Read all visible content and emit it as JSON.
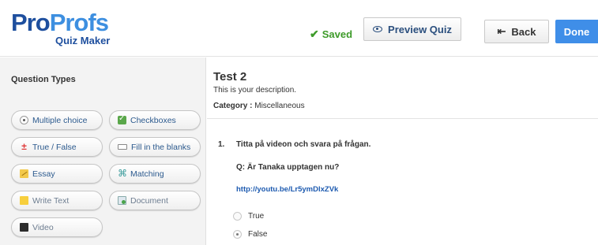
{
  "header": {
    "logo_pro": "Pro",
    "logo_profs": "Profs",
    "logo_sub": "Quiz Maker",
    "saved_label": "Saved",
    "preview_label": "Preview Quiz",
    "back_label": "Back",
    "done_label": "Done"
  },
  "sidebar": {
    "title": "Question Types",
    "types": [
      {
        "label": "Multiple choice",
        "icon": "radio-icon"
      },
      {
        "label": "Checkboxes",
        "icon": "checkbox-icon"
      },
      {
        "label": "True / False",
        "icon": "true-false-icon"
      },
      {
        "label": "Fill in the blanks",
        "icon": "blank-field-icon"
      },
      {
        "label": "Essay",
        "icon": "essay-icon"
      },
      {
        "label": "Matching",
        "icon": "matching-icon"
      },
      {
        "label": "Write Text",
        "icon": "write-text-icon"
      },
      {
        "label": "Document",
        "icon": "document-icon"
      },
      {
        "label": "Video",
        "icon": "video-icon"
      }
    ]
  },
  "quiz": {
    "title": "Test 2",
    "description": "This is your description.",
    "category_label": "Category :",
    "category_value": "Miscellaneous",
    "question": {
      "number": "1.",
      "text": "Titta på videon och svara på frågan.",
      "subtext": "Q: Är Tanaka upptagen nu?",
      "link": "http://youtu.be/Lr5ymDlxZVk",
      "answers": [
        {
          "label": "True",
          "selected": false
        },
        {
          "label": "False",
          "selected": true
        }
      ]
    }
  },
  "colors": {
    "accent": "#3f8ee8",
    "saved_green": "#3e9b2a",
    "link_blue": "#1e5bb0",
    "logo_dark": "#1e4f9e",
    "logo_light": "#3d8fe0"
  }
}
